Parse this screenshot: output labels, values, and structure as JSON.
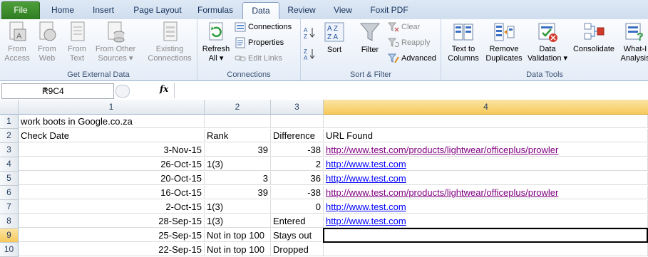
{
  "tabs": [
    "File",
    "Home",
    "Insert",
    "Page Layout",
    "Formulas",
    "Data",
    "Review",
    "View",
    "Foxit PDF"
  ],
  "ribbon": {
    "external": {
      "label": "Get External Data",
      "from_access": [
        "From",
        "Access"
      ],
      "from_web": [
        "From",
        "Web"
      ],
      "from_text": [
        "From",
        "Text"
      ],
      "from_other": [
        "From Other",
        "Sources ▾"
      ],
      "existing": [
        "Existing",
        "Connections"
      ]
    },
    "connections": {
      "label": "Connections",
      "refresh": [
        "Refresh",
        "All ▾"
      ],
      "connections": "Connections",
      "properties": "Properties",
      "edit_links": "Edit Links"
    },
    "sortfilter": {
      "label": "Sort & Filter",
      "sort": "Sort",
      "filter": "Filter",
      "clear": "Clear",
      "reapply": "Reapply",
      "advanced": "Advanced"
    },
    "tools": {
      "label": "Data Tools",
      "text_to_columns": [
        "Text to",
        "Columns"
      ],
      "remove_duplicates": [
        "Remove",
        "Duplicates"
      ],
      "data_validation": [
        "Data",
        "Validation ▾"
      ],
      "consolidate": "Consolidate",
      "what_if": [
        "What-I",
        "Analysis"
      ]
    }
  },
  "formula_bar": {
    "name_box": "R9C4",
    "fx": "fx",
    "value": ""
  },
  "columns": [
    "1",
    "2",
    "3",
    "4"
  ],
  "rows": [
    {
      "n": "1",
      "c1": "work boots in Google.co.za",
      "c2": "",
      "c3": "",
      "c4": ""
    },
    {
      "n": "2",
      "c1": "Check Date",
      "c2": "Rank",
      "c3": "Difference",
      "c4": "URL Found"
    },
    {
      "n": "3",
      "c1": "3-Nov-15",
      "c2": "39",
      "c3": "-38",
      "c4": "http://www.test.com/products/lightwear/officeplus/prowler"
    },
    {
      "n": "4",
      "c1": "26-Oct-15",
      "c2": "1(3)",
      "c3": "2",
      "c4": "http://www.test.com "
    },
    {
      "n": "5",
      "c1": "20-Oct-15",
      "c2": "3",
      "c3": "36",
      "c4": "http://www.test.com "
    },
    {
      "n": "6",
      "c1": "16-Oct-15",
      "c2": "39",
      "c3": "-38",
      "c4": "http://www.test.com/products/lightwear/officeplus/prowler"
    },
    {
      "n": "7",
      "c1": "2-Oct-15",
      "c2": "1(3)",
      "c3": "0",
      "c4": "http://www.test.com "
    },
    {
      "n": "8",
      "c1": "28-Sep-15",
      "c2": "1(3)",
      "c3": "Entered",
      "c4": "http://www.test.com "
    },
    {
      "n": "9",
      "c1": "25-Sep-15",
      "c2": "Not in top 100",
      "c3": "Stays out",
      "c4": ""
    },
    {
      "n": "10",
      "c1": "22-Sep-15",
      "c2": "Not in top 100",
      "c3": "Dropped",
      "c4": ""
    }
  ],
  "selected_cell": "R9C4",
  "colors": {
    "hyperlink": "#0000ff",
    "visited_link": "#800080",
    "file_tab": "#2f7d22",
    "header_selected": "#f6c95a"
  }
}
